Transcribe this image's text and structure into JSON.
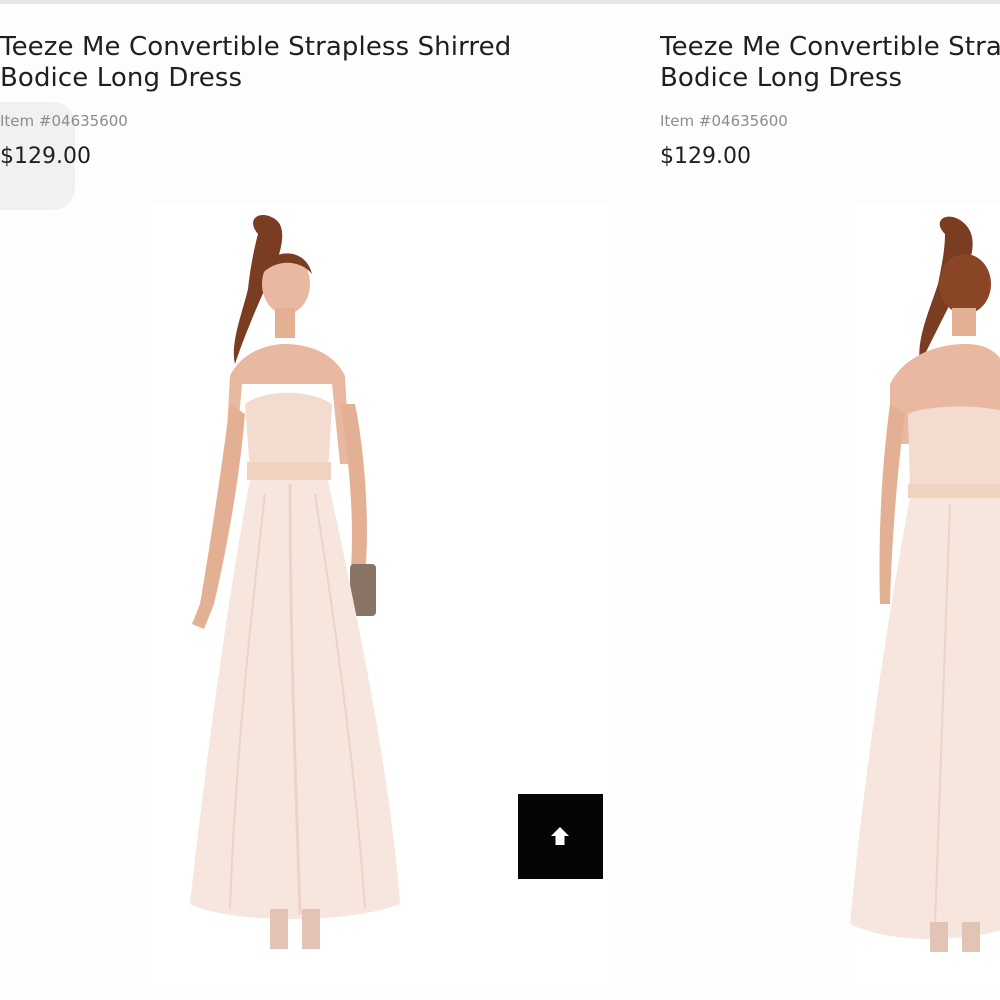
{
  "products": [
    {
      "title": "Teeze Me Convertible Strapless Shirred Bodice Long Dress",
      "item_number": "Item #04635600",
      "price": "$129.00",
      "image_alt": "front view"
    },
    {
      "title": "Teeze Me Convertible Strapless Shirred Bodice Long Dress",
      "item_number": "Item #04635600",
      "price": "$129.00",
      "image_alt": "back view"
    }
  ],
  "scroll_top": {
    "icon": "arrow-up-icon"
  },
  "colors": {
    "dress": "#f7e6dd",
    "dress_shadow": "#ecd3c6",
    "sash": "#f3d9c9",
    "hair": "#7a3d22",
    "skin": "#e8b9a0",
    "button": "#050505"
  }
}
